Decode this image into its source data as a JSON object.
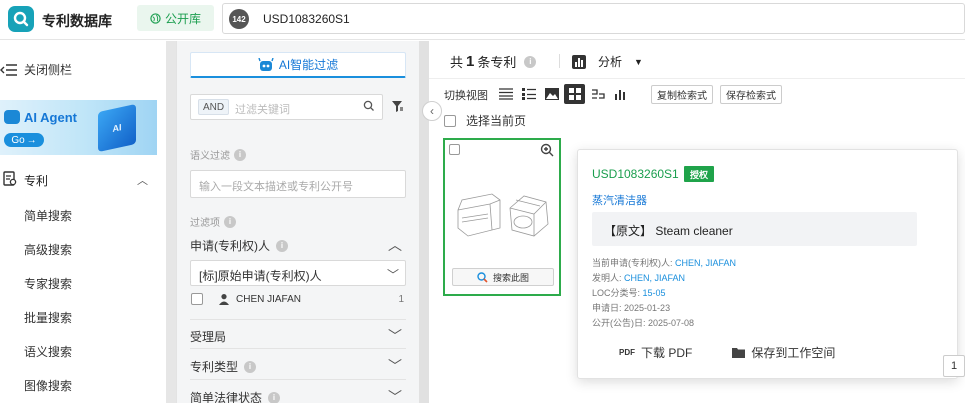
{
  "header": {
    "app_title": "专利数据库",
    "db_label": "公开库",
    "query_count": "142",
    "query_text": "USD1083260S1"
  },
  "sidebar": {
    "close_label": "关闭侧栏",
    "agent_title": "AI Agent",
    "agent_go": "Go",
    "agent_cube": "AI",
    "patent_section": "专利",
    "items": [
      "简单搜索",
      "高级搜索",
      "专家搜索",
      "批量搜索",
      "语义搜索",
      "图像搜索"
    ]
  },
  "filter": {
    "ai_filter": "AI智能过滤",
    "and_label": "AND",
    "keyword_placeholder": "过滤关键词",
    "semantic_label": "语义过滤",
    "semantic_placeholder": "输入一段文本描述或专利公开号",
    "items_label": "过滤项",
    "applicant_section": "申请(专利权)人",
    "applicant_select": "[标]原始申请(专利权)人",
    "applicant_name": "CHEN JIAFAN",
    "applicant_count": "1",
    "sections": [
      "受理局",
      "专利类型",
      "简单法律状态"
    ]
  },
  "results": {
    "total_prefix": "共",
    "total_count": "1",
    "total_suffix": "条专利",
    "analysis_label": "分析",
    "view_label": "切换视图",
    "copy_query": "复制检索式",
    "save_query": "保存检索式",
    "select_page": "选择当前页",
    "search_this_image": "搜索此图",
    "page_number": "1"
  },
  "popup": {
    "patent_id": "USD1083260S1",
    "status_badge": "授权",
    "title": "蒸汽清洁器",
    "original_title": "【原文】 Steam cleaner",
    "current_applicant_label": "当前申请(专利权)人:",
    "current_applicant": "CHEN, JIAFAN",
    "inventor_label": "发明人:",
    "inventor": "CHEN, JIAFAN",
    "loc_label": "LOC分类号:",
    "loc": "15-05",
    "filing_label": "申请日:",
    "filing_date": "2025-01-23",
    "pub_label": "公开(公告)日:",
    "pub_date": "2025-07-08",
    "download_pdf": "下载 PDF",
    "save_workspace": "保存到工作空间",
    "pdf_tag": "PDF"
  },
  "colors": {
    "brand_teal": "#17a2b8",
    "green": "#1a9e4e",
    "blue_link": "#1577d6"
  }
}
